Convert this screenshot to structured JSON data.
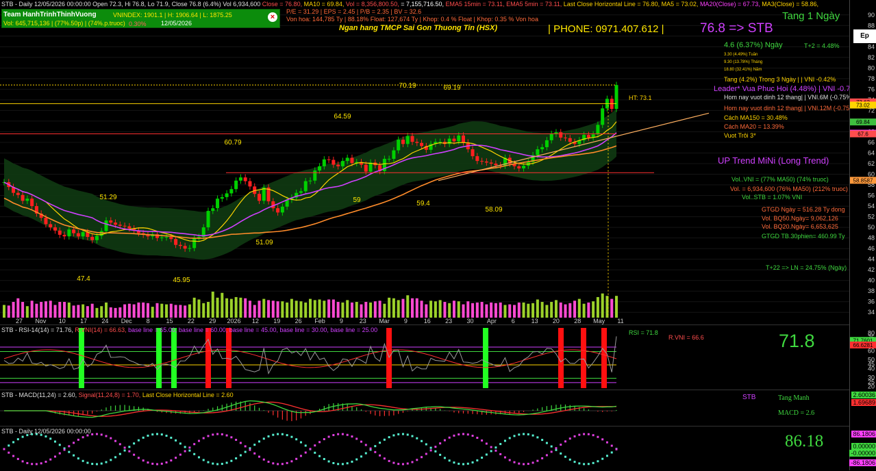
{
  "header": {
    "title_line": "STB - Daily 12/05/2026 00:00:00 Open 72.3, Hi 76.8, Lo 71.9, Close 76.8 (6.4%) Vol 6,934,600",
    "indicators": [
      {
        "text": "Close = 76.80,",
        "color": "#ff4d4d"
      },
      {
        "text": "MA10 = 69.84,",
        "color": "#ffd400"
      },
      {
        "text": "Vol = 8,356,800.50,",
        "color": "#ff4d4d"
      },
      {
        "text": "= 7,155,716.50,",
        "color": "#ffffff"
      },
      {
        "text": "EMA5 15min = 73.11,",
        "color": "#ff4d4d"
      },
      {
        "text": "EMA5 5min = 73.11,",
        "color": "#ff4d4d"
      },
      {
        "text": "Last Close Horizontal Line = 76.80,",
        "color": "#ffd400"
      },
      {
        "text": "MA5 = 73.02,",
        "color": "#ffd400"
      },
      {
        "text": "MA20(Close) = 67.73,",
        "color": "#ff40ff"
      },
      {
        "text": "MA3(Close) = 58.86,",
        "color": "#ffd400"
      }
    ],
    "team_box": {
      "name": "Team HanhTrinhThinhVuong",
      "vnindex": "VNINDEX:  1901.1 | H: 1906.64 | L: 1875.25",
      "vol": "Vol: 645,715,136 | (77%.50p) | (74%.p.truoc)",
      "pct": "0.30%",
      "date": "12/05/2026"
    },
    "fundamentals_1": "P/E = 31.29 | EPS = 2.45 | P/B = 2.35 | BV = 32.6",
    "fundamentals_2": "Von hoa: 144,785 Ty  |  88.18%  Float: 127,674 Ty  |  Khop: 0.4 % Float  |  Khop: 0.35 % Von hoa",
    "bank_name": "Ngan hang TMCP Sai Gon Thuong Tin (HSX)",
    "phone": "| PHONE: 0971.407.612 |",
    "price_target": "76.8  => STB",
    "tang_1_ngay": "Tang 1 Ngày"
  },
  "right_info": {
    "day_change": "4.6 (6.37%) Ngày",
    "t_plus_2": "T+2 = 4.48%",
    "week": "3.30 (4.49%) Tuần",
    "month": "9.30 (13.78%) Tháng",
    "year": "18.80 (32.41%) Năm",
    "tang_3_ngay": "Tang (4.2%) Trong 3 Ngày | | VNI -0.42%",
    "leader": "Leader* Vua Phuc Hoi (4.48%) | VNI -0.75%",
    "peak_6m": "Hom nay vuot dinh 12 thang| | VNI.6M (-0.75%)",
    "peak_12m": "Hom nay vuot dinh 12 thang| | VNI.12M (-0.75%)",
    "ma150": "Cách MA150 = 30.48%",
    "ma20": "Cách MA20 = 13.39%",
    "vuot_troi": "Vuot Trôi 3*",
    "trend": "UP Trend MiNi (Long Trend)",
    "vol_vni": "Vol..VNI = (77% MA50)   (74% truoc)",
    "vol_stb": "Vol. = 6,934,600  (76% MA50)   (212% truoc)",
    "vol_stb_vni": "Vol..STB = 1.07% VNI",
    "gtgd": "GTGD Ngày = 516.28 Ty dong",
    "bq50": "Vol. BQ50.Ngày= 9,062,126",
    "bq20": "Vol. BQ20.Ngày= 6,653,625",
    "gtgd30": "GTGD TB.30phien= 460.99 Ty",
    "t22": "T+22 => LN = 24.75%   (Ngày)",
    "ht": "HT:  73.1"
  },
  "chart_data": {
    "type": "candlestick",
    "symbol": "STB",
    "ylim": [
      33,
      91
    ],
    "y_ticks": [
      34,
      36,
      38,
      40,
      42,
      44,
      46,
      48,
      50,
      52,
      54,
      56,
      58,
      60,
      62,
      64,
      66,
      68,
      70,
      72,
      74,
      76,
      78,
      80,
      82,
      84,
      86,
      88,
      90
    ],
    "x_labels": [
      "27",
      "Nov",
      "10",
      "17",
      "24",
      "Dec",
      "8",
      "15",
      "22",
      "29",
      "2026",
      "12",
      "19",
      "26",
      "Feb",
      "9",
      "23",
      "Mar",
      "9",
      "16",
      "23",
      "30",
      "Apr",
      "6",
      "13",
      "20",
      "28",
      "May",
      "11"
    ],
    "last_close": 76.8,
    "price_annotations": [
      "70.19",
      "69.19",
      "64.59",
      "60.79",
      "51.29",
      "47.4",
      "45.95",
      "51.09",
      "59",
      "59.4",
      "58.09"
    ],
    "price_tags": [
      {
        "label": "73.62",
        "color": "#ff4d4d"
      },
      {
        "label": "73.02",
        "color": "#ffd400"
      },
      {
        "label": "69.84",
        "color": "#3fbf3f"
      },
      {
        "label": "67.73",
        "color": "#ff40ff"
      },
      {
        "label": "67.6",
        "color": "#ff4d4d"
      },
      {
        "label": "58.8587",
        "color": "#ff9a3c"
      }
    ],
    "closes": [
      58.5,
      57.6,
      56.5,
      56.1,
      55,
      55.4,
      54,
      52.6,
      51.8,
      50.6,
      50,
      49.4,
      48.6,
      48.3,
      49.6,
      48.9,
      48.3,
      49.1,
      48.2,
      47.6,
      48.4,
      49.3,
      51.3,
      50.9,
      50.5,
      50.3,
      50.2,
      49.8,
      49.4,
      48.9,
      48.6,
      48.3,
      48.7,
      48,
      48.1,
      48.2,
      47.8,
      46.7,
      46.5,
      46,
      46.1,
      47.9,
      48.2,
      50,
      53.1,
      53.6,
      55.4,
      55.7,
      56.4,
      57.2,
      58.8,
      59.4,
      58.7,
      57.7,
      56.3,
      55,
      57.5,
      54.9,
      53.6,
      52.8,
      53.9,
      55.2,
      55.6,
      56.5,
      56.8,
      58.7,
      58.8,
      60.7,
      61.5,
      62.8,
      62.7,
      61.8,
      61.5,
      62.5,
      63.1,
      62.1,
      62.3,
      61.8,
      60.5,
      62.2,
      61.7,
      60.6,
      62.9,
      62.9,
      64.5,
      66.5,
      65.7,
      67.2,
      66.1,
      65.9,
      65.3,
      64.6,
      65.7,
      66.1,
      66.1,
      65.7,
      66.7,
      66.2,
      67.3,
      66,
      64.7,
      63.4,
      62.5,
      62.4,
      62.2,
      62,
      61.7,
      61.6,
      63.1,
      62,
      61.5,
      61.1,
      61.6,
      62.3,
      63.6,
      64.7,
      65.1,
      66.4,
      67.6,
      67.9,
      66.9,
      66.8,
      66.1,
      65.7,
      66.4,
      67.4,
      66.9,
      67.5,
      69.3,
      72.4,
      74.2,
      72.3,
      76.8
    ],
    "volumes": [
      2.1,
      2,
      2.6,
      3.2,
      2.6,
      1.9,
      2.8,
      2.3,
      2.6,
      2.7,
      2.8,
      2.1,
      2.6,
      2.6,
      2.5,
      2,
      2.1,
      2.2,
      1.9,
      2.3,
      1.6,
      1.9,
      2.5,
      1.7,
      1.6,
      1.7,
      2.2,
      2.3,
      2.2,
      2.5,
      2.5,
      2.4,
      1.8,
      2.4,
      2.3,
      2.2,
      2.3,
      2.1,
      2.1,
      2,
      2.2,
      3.3,
      3,
      2.4,
      2.6,
      4.3,
      3.3,
      4.1,
      3.2,
      3.1,
      3.4,
      3.3,
      3.2,
      2.8,
      2.1,
      2.8,
      3.1,
      2.9,
      2.8,
      2.7,
      2.7,
      2.5,
      3.1,
      2.8,
      2.7,
      2.5,
      3.1,
      2.9,
      3,
      2.8,
      3,
      3,
      2.6,
      2.5,
      2.9,
      2.5,
      2.6,
      2.2,
      2.6,
      2.5,
      2.7,
      2.8,
      2.3,
      3.3,
      3.2,
      2.9,
      3.1,
      3.7,
      3.2,
      3.2,
      2.8,
      2.2,
      2.8,
      2.7,
      2.9,
      2.6,
      2.4,
      2.8,
      2.7,
      2.2,
      2.7,
      2.4,
      2.5,
      2.6,
      2.2,
      2.5,
      2.4,
      2.5,
      2.1,
      2.2,
      2.1,
      2.5,
      2.5,
      2.3,
      2.4,
      3,
      2.6,
      2.1,
      2.6,
      2.9,
      2.5,
      2.2,
      2.4,
      2.8,
      3.1,
      2.3,
      2.5,
      2.7,
      3.4,
      4,
      3.6,
      3.1,
      3.6
    ],
    "rsi": {
      "label": "STB - RSI-14(14) = 71.76,",
      "rvni": "R.VNI(14) = 66.63,",
      "baselines": "base line = 65.00, base line = 60.00, base line = 45.00, base line = 30.00, base line = 25.00",
      "value": "71.8",
      "right_rsi": "RSI = 71.8",
      "right_rvni": "R.VNI = 66.6",
      "ylim": [
        18,
        82
      ],
      "ticks": [
        20,
        25,
        30,
        40,
        45,
        50,
        60,
        65,
        70,
        75,
        80
      ],
      "tag_rsi": "71.7601",
      "tag_rvni": "66.6281"
    },
    "macd": {
      "label": "STB - MACD(11,24) = 2.60,",
      "signal": "Signal(11,24,8) = 1.70,",
      "lchl": "Last Close Horizontal Line = 2.60",
      "name": "STB",
      "status": "Tang Manh",
      "value": "MACD = 2.6",
      "tag_macd": "2.60036",
      "tag_signal": "1.69689"
    },
    "osc": {
      "label": "STB - Daily 12/05/2026 00:00:00",
      "value": "86.18",
      "tag_top": "86.1806",
      "tag_mid1": "0.00000",
      "tag_mid2": "-0.00000",
      "tag_bot": "-86.1806"
    }
  },
  "colors": {
    "up": "#00d000",
    "down": "#ff2020",
    "ma_yellow": "#ffd400",
    "ma_magenta": "#d040ff",
    "ma_orange": "#ff8c2a",
    "cloud_green": "#0f3a12",
    "cloud_red": "#3a1210"
  }
}
